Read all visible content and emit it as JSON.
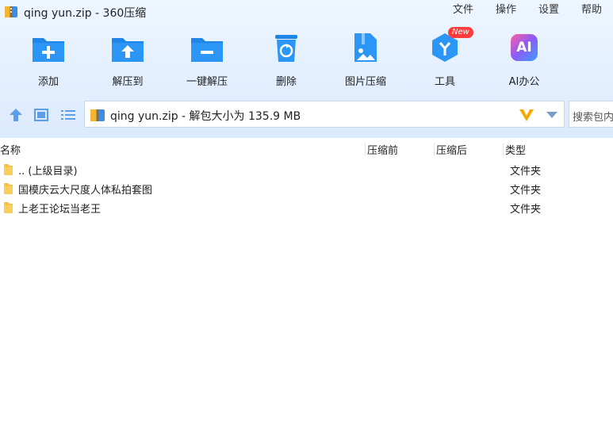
{
  "window": {
    "title": "qing yun.zip - 360压缩"
  },
  "menu": [
    {
      "label": "文件"
    },
    {
      "label": "操作"
    },
    {
      "label": "设置"
    },
    {
      "label": "帮助"
    }
  ],
  "toolbar": {
    "add": "添加",
    "extract_to": "解压到",
    "one_click_extract": "一键解压",
    "delete": "删除",
    "image_compress": "图片压缩",
    "tools": "工具",
    "tools_badge": "New",
    "ai_office": "AI办公",
    "ai_icon_text": "AI"
  },
  "address": {
    "path": "qing yun.zip - 解包大小为 135.9 MB",
    "search_placeholder": "搜索包内"
  },
  "columns": {
    "name": "名称",
    "compressed": "压缩前",
    "uncompressed": "压缩后",
    "type": "类型"
  },
  "rows": [
    {
      "name": ".. (上级目录)",
      "type": "文件夹"
    },
    {
      "name": "国模庆云大尺度人体私拍套图",
      "type": "文件夹"
    },
    {
      "name": "上老王论坛当老王",
      "type": "文件夹"
    }
  ],
  "colors": {
    "accent": "#2b8cf0",
    "folder": "#f5c244"
  }
}
